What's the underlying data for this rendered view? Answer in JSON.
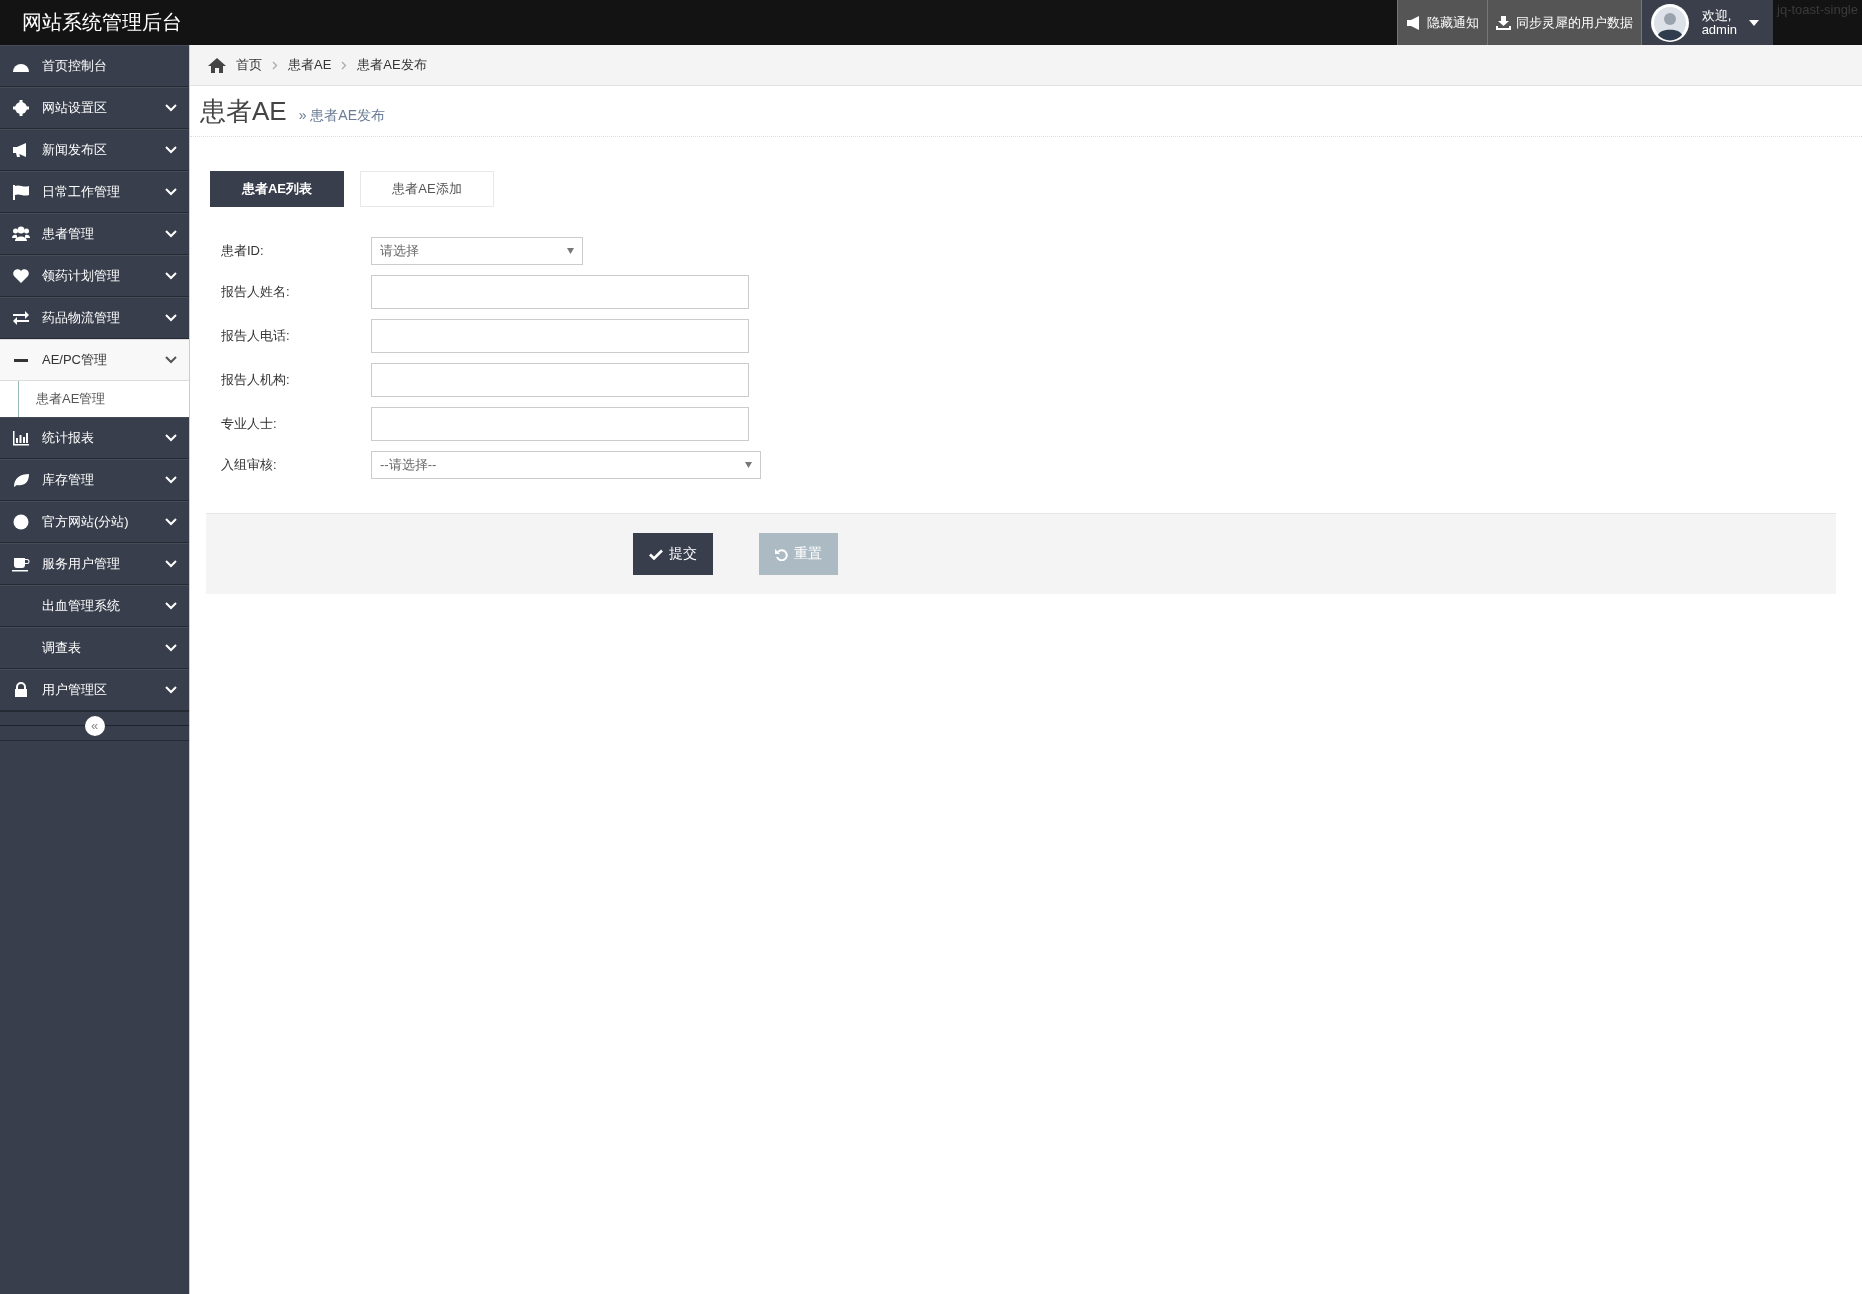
{
  "header": {
    "title": "网站系统管理后台",
    "actions": [
      {
        "label": "隐藏通知"
      },
      {
        "label": "同步灵犀的用户数据"
      }
    ],
    "user": {
      "greeting": "欢迎,",
      "name": "admin"
    },
    "stray_text": "jq-toast-single"
  },
  "sidebar": {
    "items": [
      {
        "label": "首页控制台",
        "kind": "link",
        "expanded": false
      },
      {
        "label": "网站设置区",
        "kind": "menu",
        "expanded": false
      },
      {
        "label": "新闻发布区",
        "kind": "menu",
        "expanded": false
      },
      {
        "label": "日常工作管理",
        "kind": "menu",
        "expanded": false
      },
      {
        "label": "患者管理",
        "kind": "menu",
        "expanded": false
      },
      {
        "label": "领药计划管理",
        "kind": "menu",
        "expanded": false
      },
      {
        "label": "药品物流管理",
        "kind": "menu",
        "expanded": false
      },
      {
        "label": "AE/PC管理",
        "kind": "menu",
        "expanded": true,
        "children": [
          {
            "label": "患者AE管理"
          }
        ]
      },
      {
        "label": "统计报表",
        "kind": "menu",
        "expanded": false
      },
      {
        "label": "库存管理",
        "kind": "menu",
        "expanded": false
      },
      {
        "label": "官方网站(分站)",
        "kind": "menu",
        "expanded": false
      },
      {
        "label": "服务用户管理",
        "kind": "menu",
        "expanded": false
      },
      {
        "label": "出血管理系统",
        "kind": "menu",
        "expanded": false
      },
      {
        "label": "调查表",
        "kind": "menu",
        "expanded": false
      },
      {
        "label": "用户管理区",
        "kind": "menu",
        "expanded": false
      }
    ],
    "collapse_label": "«"
  },
  "breadcrumb": [
    "首页",
    "患者AE",
    "患者AE发布"
  ],
  "page_title": {
    "title": "患者AE",
    "subtitle": "患者AE发布",
    "separator": "»"
  },
  "tabs": [
    {
      "label": "患者AE列表",
      "selected": true
    },
    {
      "label": "患者AE添加",
      "selected": false
    }
  ],
  "form": {
    "fields": [
      {
        "label": "患者ID:",
        "kind": "select",
        "placeholder": "请选择"
      },
      {
        "label": "报告人姓名:",
        "kind": "text"
      },
      {
        "label": "报告人电话:",
        "kind": "text"
      },
      {
        "label": "报告人机构:",
        "kind": "text"
      },
      {
        "label": "专业人士:",
        "kind": "text"
      },
      {
        "label": "入组审核:",
        "kind": "wide-select",
        "placeholder": "--请选择--"
      }
    ],
    "buttons": [
      {
        "label": "提交",
        "kind": "submit"
      },
      {
        "label": "重置",
        "kind": "reset"
      }
    ]
  }
}
